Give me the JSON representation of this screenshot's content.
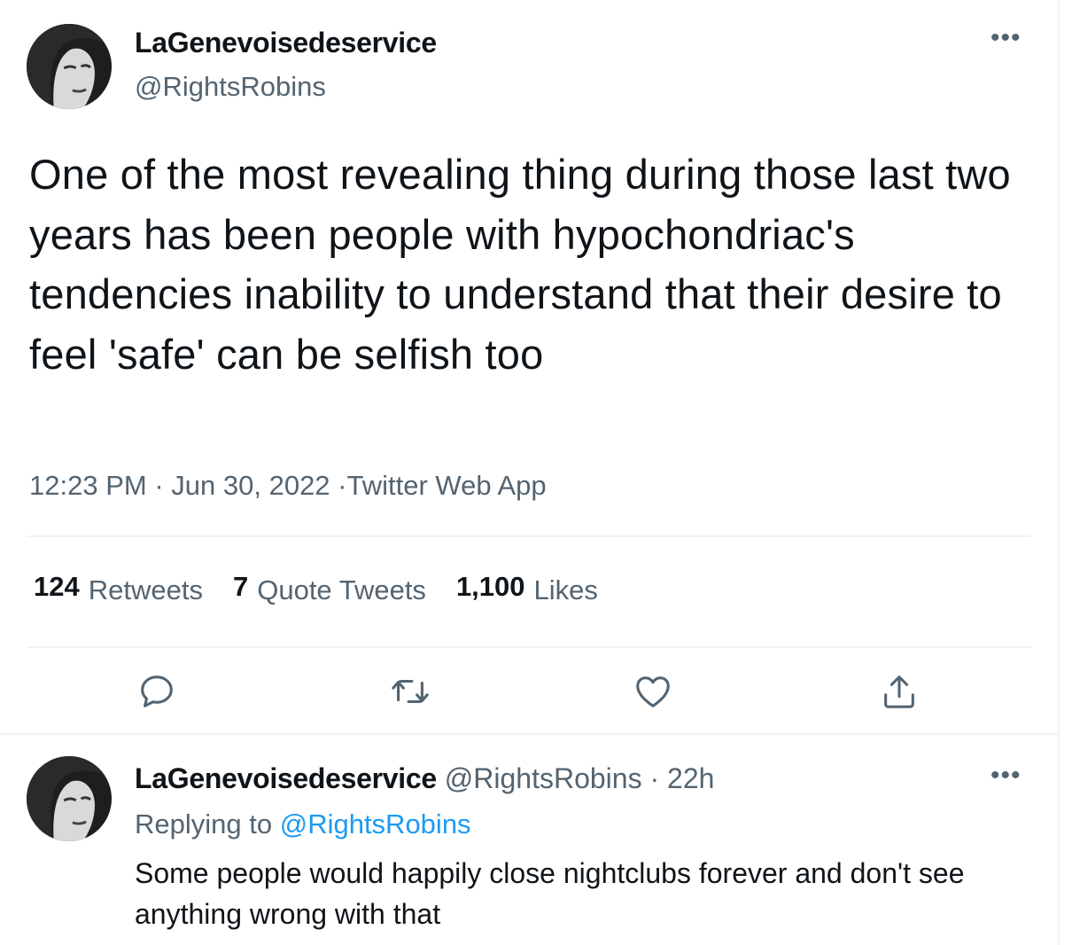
{
  "tweet": {
    "author_name": "LaGenevoisedeservice",
    "author_handle": "@RightsRobins",
    "more_label": "•••",
    "text": "One of the most revealing thing during those last two years has been people with hypochondriac's tendencies inability to understand that their desire to feel 'safe' can be selfish too",
    "time": "12:23 PM",
    "separator": "·",
    "date": "Jun 30, 2022",
    "source": "Twitter Web App",
    "stats": {
      "retweets_count": "124",
      "retweets_label": "Retweets",
      "quotes_count": "7",
      "quotes_label": "Quote Tweets",
      "likes_count": "1,100",
      "likes_label": "Likes"
    },
    "actions": [
      "reply-icon",
      "retweet-icon",
      "like-icon",
      "share-icon"
    ]
  },
  "reply": {
    "author_name": "LaGenevoisedeservice",
    "author_handle": "@RightsRobins",
    "separator": "·",
    "age": "22h",
    "more_label": "•••",
    "replying_prefix": "Replying to",
    "replying_to": "@RightsRobins",
    "text": "Some people would happily close nightclubs forever and don't see anything wrong with that"
  },
  "colors": {
    "text": "#0f1419",
    "secondary": "#536471",
    "link": "#1d9bf0",
    "divider": "#eff3f4"
  }
}
